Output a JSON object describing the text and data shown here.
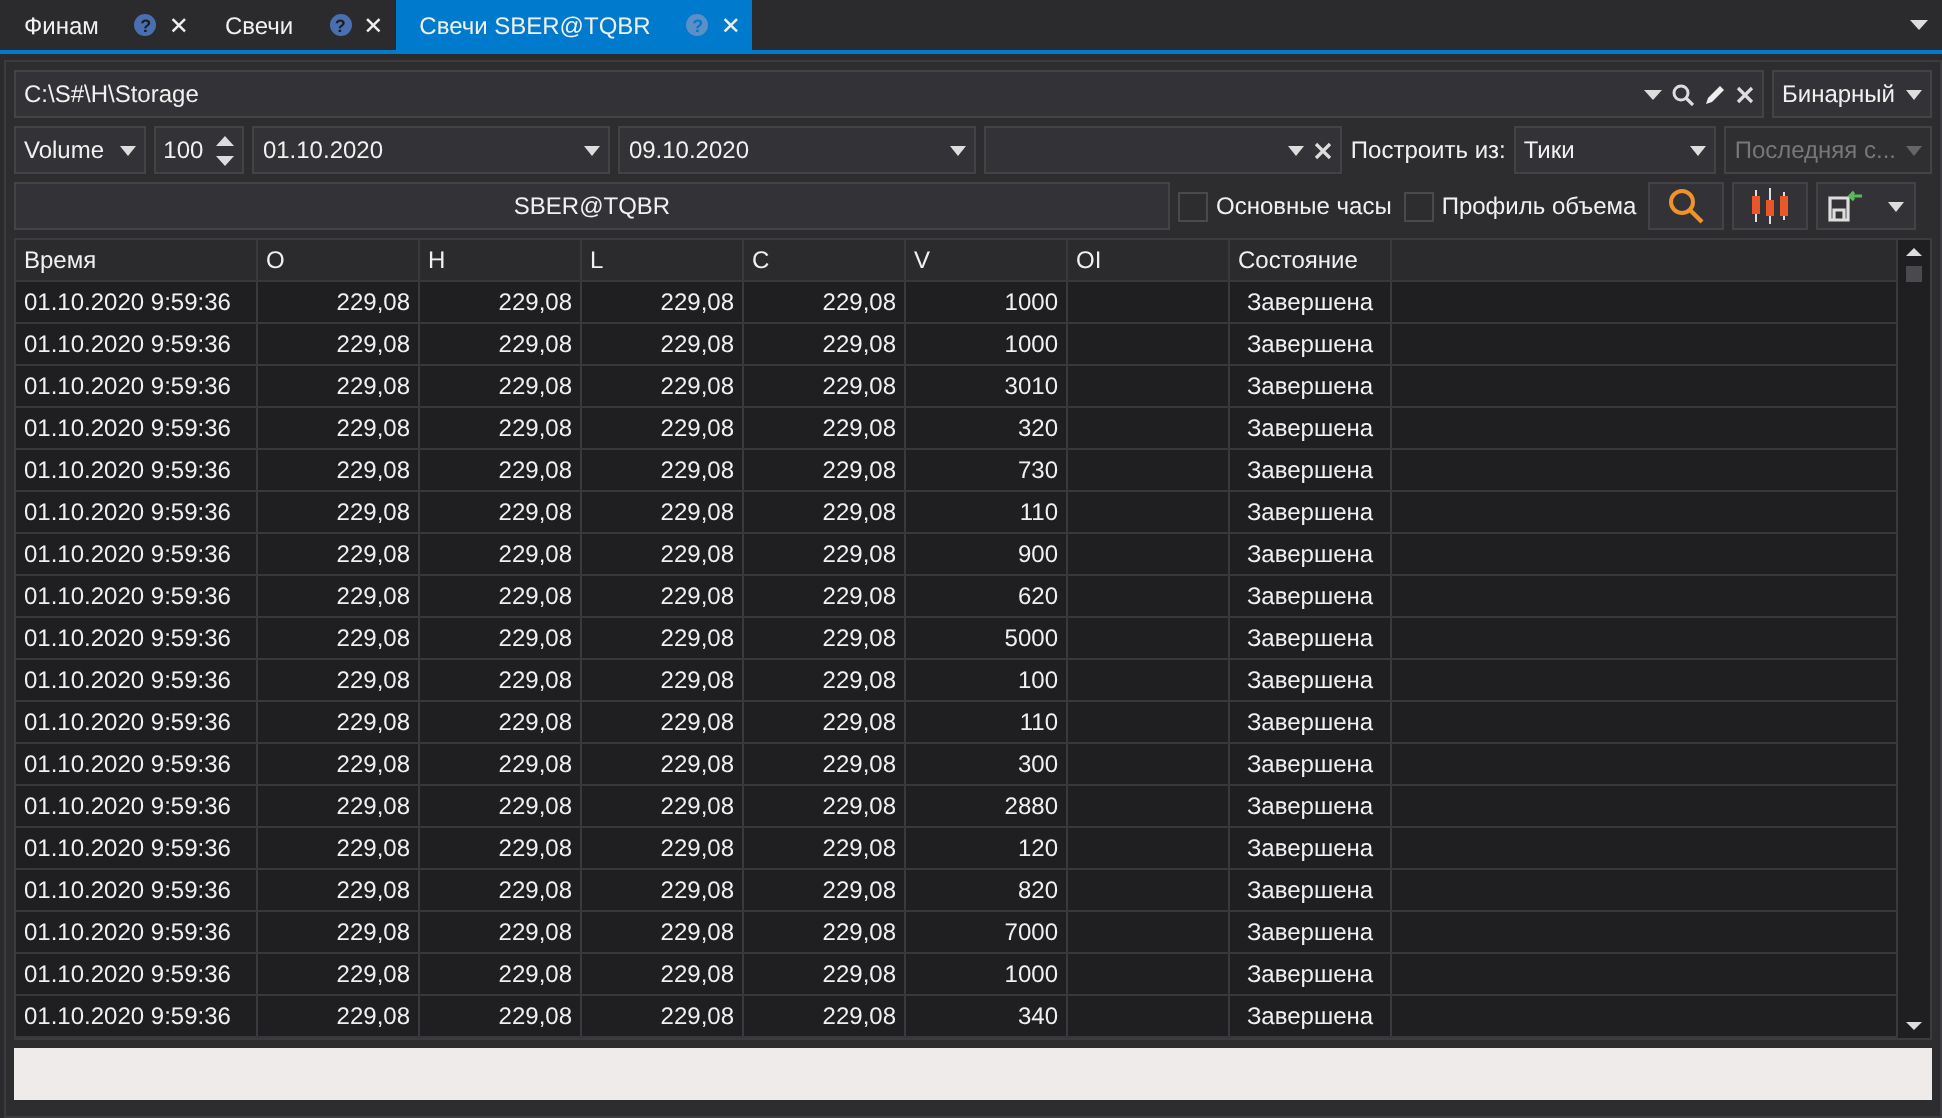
{
  "tabs": [
    {
      "label": "Финам",
      "selected": false,
      "help": "?",
      "close": "✕"
    },
    {
      "label": "Свечи",
      "selected": false,
      "help": "?",
      "close": "✕"
    },
    {
      "label": "Свечи SBER@TQBR",
      "selected": true,
      "help": "?",
      "close": "✕"
    }
  ],
  "path_field": {
    "value": "C:\\S#\\H\\Storage"
  },
  "format_select": {
    "value": "Бинарный"
  },
  "type_select": {
    "value": "Volume"
  },
  "size_spinner": {
    "value": "100"
  },
  "from_date": {
    "value": "01.10.2020"
  },
  "to_date": {
    "value": "09.10.2020"
  },
  "build_from_label": "Построить из:",
  "build_from_select": {
    "value": "Тики"
  },
  "source_select": {
    "value": "Последняя с...",
    "disabled": true
  },
  "security_field": {
    "value": "SBER@TQBR"
  },
  "checkboxes": [
    {
      "label": "Основные часы",
      "checked": false
    },
    {
      "label": "Профиль объема",
      "checked": false
    }
  ],
  "table": {
    "columns": [
      "Время",
      "O",
      "H",
      "L",
      "C",
      "V",
      "OI",
      "Состояние"
    ],
    "rows": [
      {
        "time": "01.10.2020 9:59:36",
        "o": "229,08",
        "h": "229,08",
        "l": "229,08",
        "c": "229,08",
        "v": "1000",
        "state": "Завершена"
      },
      {
        "time": "01.10.2020 9:59:36",
        "o": "229,08",
        "h": "229,08",
        "l": "229,08",
        "c": "229,08",
        "v": "1000",
        "state": "Завершена"
      },
      {
        "time": "01.10.2020 9:59:36",
        "o": "229,08",
        "h": "229,08",
        "l": "229,08",
        "c": "229,08",
        "v": "3010",
        "state": "Завершена"
      },
      {
        "time": "01.10.2020 9:59:36",
        "o": "229,08",
        "h": "229,08",
        "l": "229,08",
        "c": "229,08",
        "v": "320",
        "state": "Завершена"
      },
      {
        "time": "01.10.2020 9:59:36",
        "o": "229,08",
        "h": "229,08",
        "l": "229,08",
        "c": "229,08",
        "v": "730",
        "state": "Завершена"
      },
      {
        "time": "01.10.2020 9:59:36",
        "o": "229,08",
        "h": "229,08",
        "l": "229,08",
        "c": "229,08",
        "v": "110",
        "state": "Завершена"
      },
      {
        "time": "01.10.2020 9:59:36",
        "o": "229,08",
        "h": "229,08",
        "l": "229,08",
        "c": "229,08",
        "v": "900",
        "state": "Завершена"
      },
      {
        "time": "01.10.2020 9:59:36",
        "o": "229,08",
        "h": "229,08",
        "l": "229,08",
        "c": "229,08",
        "v": "620",
        "state": "Завершена"
      },
      {
        "time": "01.10.2020 9:59:36",
        "o": "229,08",
        "h": "229,08",
        "l": "229,08",
        "c": "229,08",
        "v": "5000",
        "state": "Завершена"
      },
      {
        "time": "01.10.2020 9:59:36",
        "o": "229,08",
        "h": "229,08",
        "l": "229,08",
        "c": "229,08",
        "v": "100",
        "state": "Завершена"
      },
      {
        "time": "01.10.2020 9:59:36",
        "o": "229,08",
        "h": "229,08",
        "l": "229,08",
        "c": "229,08",
        "v": "110",
        "state": "Завершена"
      },
      {
        "time": "01.10.2020 9:59:36",
        "o": "229,08",
        "h": "229,08",
        "l": "229,08",
        "c": "229,08",
        "v": "300",
        "state": "Завершена"
      },
      {
        "time": "01.10.2020 9:59:36",
        "o": "229,08",
        "h": "229,08",
        "l": "229,08",
        "c": "229,08",
        "v": "2880",
        "state": "Завершена"
      },
      {
        "time": "01.10.2020 9:59:36",
        "o": "229,08",
        "h": "229,08",
        "l": "229,08",
        "c": "229,08",
        "v": "120",
        "state": "Завершена"
      },
      {
        "time": "01.10.2020 9:59:36",
        "o": "229,08",
        "h": "229,08",
        "l": "229,08",
        "c": "229,08",
        "v": "820",
        "state": "Завершена"
      },
      {
        "time": "01.10.2020 9:59:36",
        "o": "229,08",
        "h": "229,08",
        "l": "229,08",
        "c": "229,08",
        "v": "7000",
        "state": "Завершена"
      },
      {
        "time": "01.10.2020 9:59:36",
        "o": "229,08",
        "h": "229,08",
        "l": "229,08",
        "c": "229,08",
        "v": "1000",
        "state": "Завершена"
      },
      {
        "time": "01.10.2020 9:59:36",
        "o": "229,08",
        "h": "229,08",
        "l": "229,08",
        "c": "229,08",
        "v": "340",
        "state": "Завершена"
      }
    ]
  }
}
